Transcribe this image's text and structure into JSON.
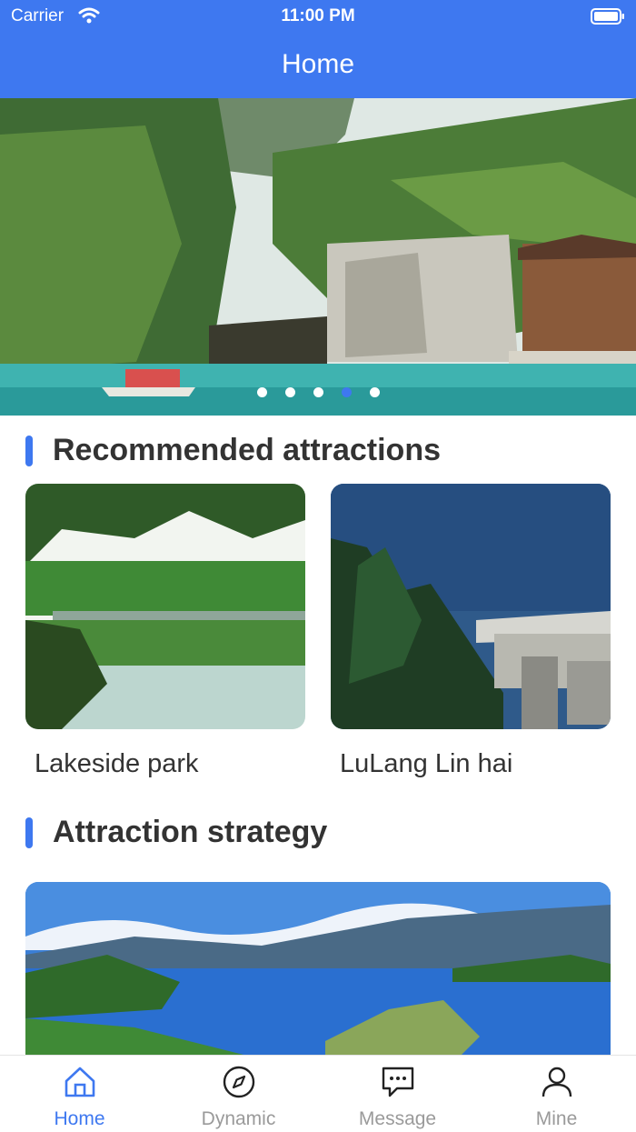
{
  "status_bar": {
    "carrier": "Carrier",
    "time": "11:00 PM"
  },
  "nav": {
    "title": "Home"
  },
  "banner": {
    "slide_count": 5,
    "active_index": 3
  },
  "recommended": {
    "title": "Recommended attractions",
    "items": [
      {
        "name": "Lakeside park"
      },
      {
        "name": "LuLang Lin hai"
      }
    ]
  },
  "strategy": {
    "title": "Attraction strategy"
  },
  "tabs": [
    {
      "label": "Home",
      "icon": "home-icon",
      "active": true
    },
    {
      "label": "Dynamic",
      "icon": "compass-icon",
      "active": false
    },
    {
      "label": "Message",
      "icon": "message-icon",
      "active": false
    },
    {
      "label": "Mine",
      "icon": "user-icon",
      "active": false
    }
  ],
  "colors": {
    "accent": "#3e78f0",
    "inactive_tab": "#9a9a9a",
    "text": "#333333"
  }
}
